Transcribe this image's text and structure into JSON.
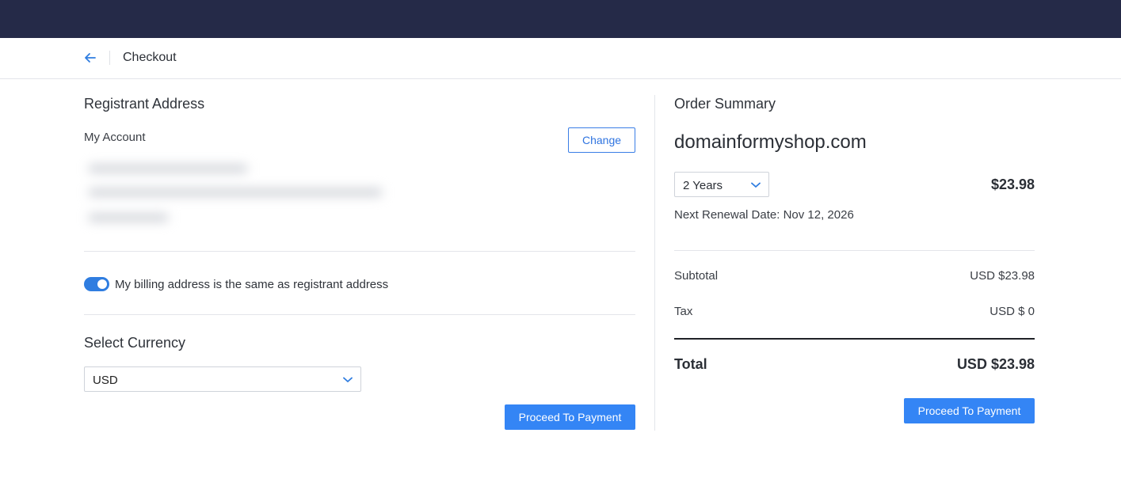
{
  "header": {
    "title": "Checkout",
    "back_icon": "arrow-left-icon"
  },
  "left": {
    "registrant_title": "Registrant Address",
    "account_label": "My Account",
    "change_label": "Change",
    "billing_toggle": {
      "label": "My billing address is the same as registrant address",
      "checked": true
    },
    "currency_title": "Select Currency",
    "currency_value": "USD",
    "proceed_label": "Proceed To Payment"
  },
  "summary": {
    "title": "Order Summary",
    "domain": "domainformyshop.com",
    "term": "2 Years",
    "price": "$23.98",
    "renewal": "Next Renewal Date: Nov 12, 2026",
    "subtotal_label": "Subtotal",
    "subtotal_value": "USD $23.98",
    "tax_label": "Tax",
    "tax_value": "USD $ 0",
    "total_label": "Total",
    "total_value": "USD $23.98",
    "proceed_label": "Proceed To Payment"
  },
  "colors": {
    "topbar": "#252a48",
    "accent": "#3485f5"
  }
}
